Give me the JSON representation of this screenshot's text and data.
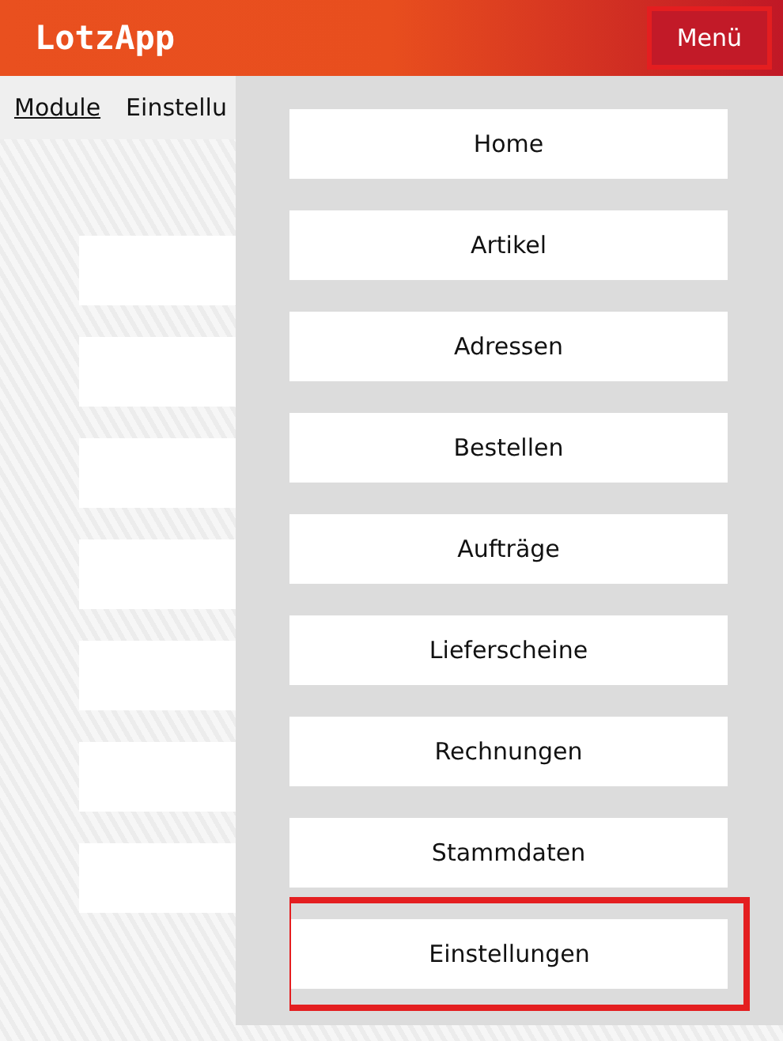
{
  "header": {
    "logo": "LotzApp",
    "menu_button": {
      "label": "Menü",
      "highlighted": true
    }
  },
  "nav": [
    {
      "label": "Module",
      "selected": true
    },
    {
      "label": "Einstellu",
      "selected": false
    }
  ],
  "menu": {
    "items": [
      {
        "label": "Home",
        "highlighted": false
      },
      {
        "label": "Artikel",
        "highlighted": false
      },
      {
        "label": "Adressen",
        "highlighted": false
      },
      {
        "label": "Bestellen",
        "highlighted": false
      },
      {
        "label": "Aufträge",
        "highlighted": false
      },
      {
        "label": "Lieferscheine",
        "highlighted": false
      },
      {
        "label": "Rechnungen",
        "highlighted": false
      },
      {
        "label": "Stammdaten",
        "highlighted": false
      },
      {
        "label": "Einstellungen",
        "highlighted": true
      }
    ]
  }
}
